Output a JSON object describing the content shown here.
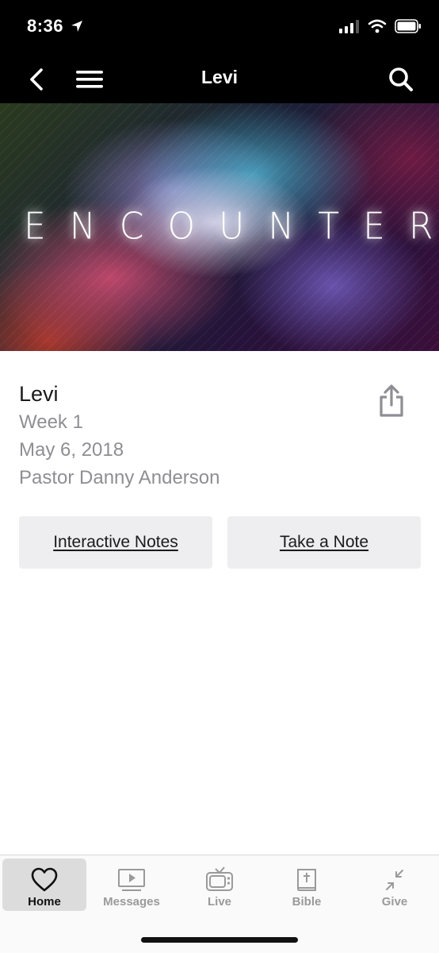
{
  "status_bar": {
    "time": "8:36"
  },
  "nav": {
    "title": "Levi"
  },
  "hero": {
    "title": "ENCOUNTERS"
  },
  "sermon": {
    "title": "Levi",
    "week": "Week 1",
    "date": "May 6, 2018",
    "speaker": "Pastor Danny Anderson"
  },
  "actions": {
    "interactive_notes": "Interactive Notes",
    "take_note": "Take a Note"
  },
  "tabs": [
    {
      "label": "Home",
      "icon": "heart-icon",
      "active": true
    },
    {
      "label": "Messages",
      "icon": "play-screen-icon",
      "active": false
    },
    {
      "label": "Live",
      "icon": "tv-icon",
      "active": false
    },
    {
      "label": "Bible",
      "icon": "bible-icon",
      "active": false
    },
    {
      "label": "Give",
      "icon": "compress-arrows-icon",
      "active": false
    }
  ],
  "colors": {
    "nav_bg": "#000000",
    "muted_text": "#8e8e93",
    "button_bg": "#eeeef0",
    "tab_active_bg": "#dcdcdc"
  }
}
